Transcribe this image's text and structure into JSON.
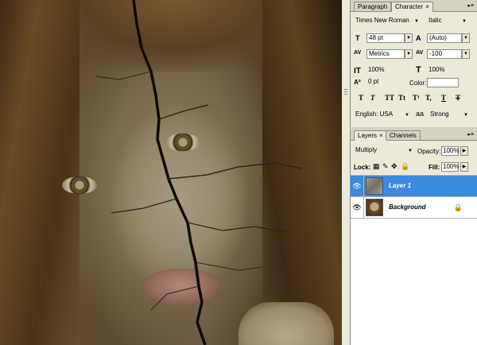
{
  "canvas": {
    "image": "cracked-face-photo"
  },
  "character_panel": {
    "tabs": [
      {
        "label": "Paragraph",
        "active": false
      },
      {
        "label": "Character",
        "active": true,
        "close": "×"
      }
    ],
    "menu_icon": "▸≡",
    "font_family": "Times New Roman",
    "font_style": "Italic",
    "font_size": "48 pt",
    "leading": "(Auto)",
    "kerning": "Metrics",
    "tracking": "-100",
    "vertical_scale": "100%",
    "horizontal_scale": "100%",
    "baseline_shift": "0 pt",
    "color_label": "Color:",
    "format_buttons": [
      "T",
      "T",
      "TT",
      "Tt",
      "T¹",
      "T,",
      "T",
      "T"
    ],
    "language": "English: USA",
    "aa_icon": "aa",
    "antialias": "Strong"
  },
  "layers_panel": {
    "tabs": [
      {
        "label": "Layers",
        "active": true,
        "close": "×"
      },
      {
        "label": "Channels",
        "active": false
      }
    ],
    "blend_mode": "Multiply",
    "opacity_label": "Opacity:",
    "opacity": "100%",
    "lock_label": "Lock:",
    "fill_label": "Fill:",
    "fill": "100%",
    "layers": [
      {
        "name": "Layer 1",
        "selected": true,
        "visible": true,
        "thumb": "texture"
      },
      {
        "name": "Background",
        "selected": false,
        "visible": true,
        "thumb": "face",
        "locked": true
      }
    ]
  },
  "colors": {
    "selection": "#3a8ae0",
    "panel_bg": "#ece9d8"
  }
}
